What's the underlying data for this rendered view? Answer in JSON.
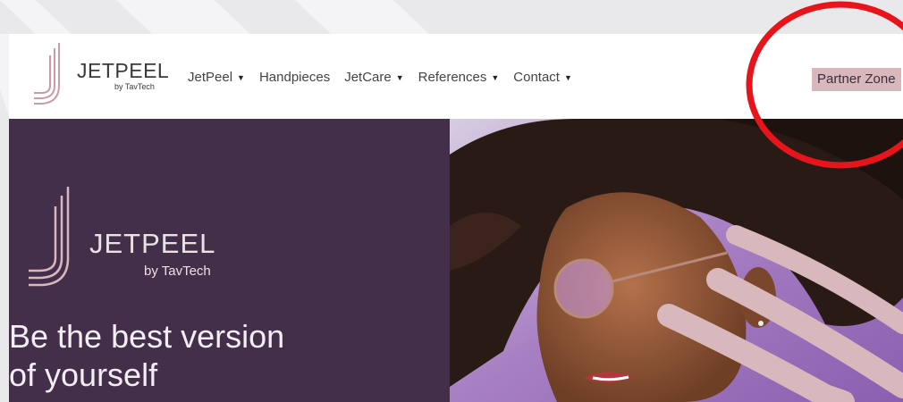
{
  "colors": {
    "brand_purple": "#442f4b",
    "brand_pink": "#d9b8bd",
    "annotation_red": "#e8141b"
  },
  "header": {
    "logo": {
      "word": "JETPEEL",
      "sub": "by TavTech"
    },
    "nav": [
      {
        "label": "JetPeel",
        "dropdown": true
      },
      {
        "label": "Handpieces",
        "dropdown": false
      },
      {
        "label": "JetCare",
        "dropdown": true
      },
      {
        "label": "References",
        "dropdown": true
      },
      {
        "label": "Contact",
        "dropdown": true
      }
    ],
    "partner_button": "Partner Zone"
  },
  "hero": {
    "logo": {
      "word": "JETPEEL",
      "sub": "by TavTech"
    },
    "headline_line1": "Be the best version",
    "headline_line2": "of yourself",
    "image_icon": "woman-with-glasses-photo"
  },
  "annotation": {
    "shape": "red-ellipse",
    "target": "partner-zone-button"
  }
}
